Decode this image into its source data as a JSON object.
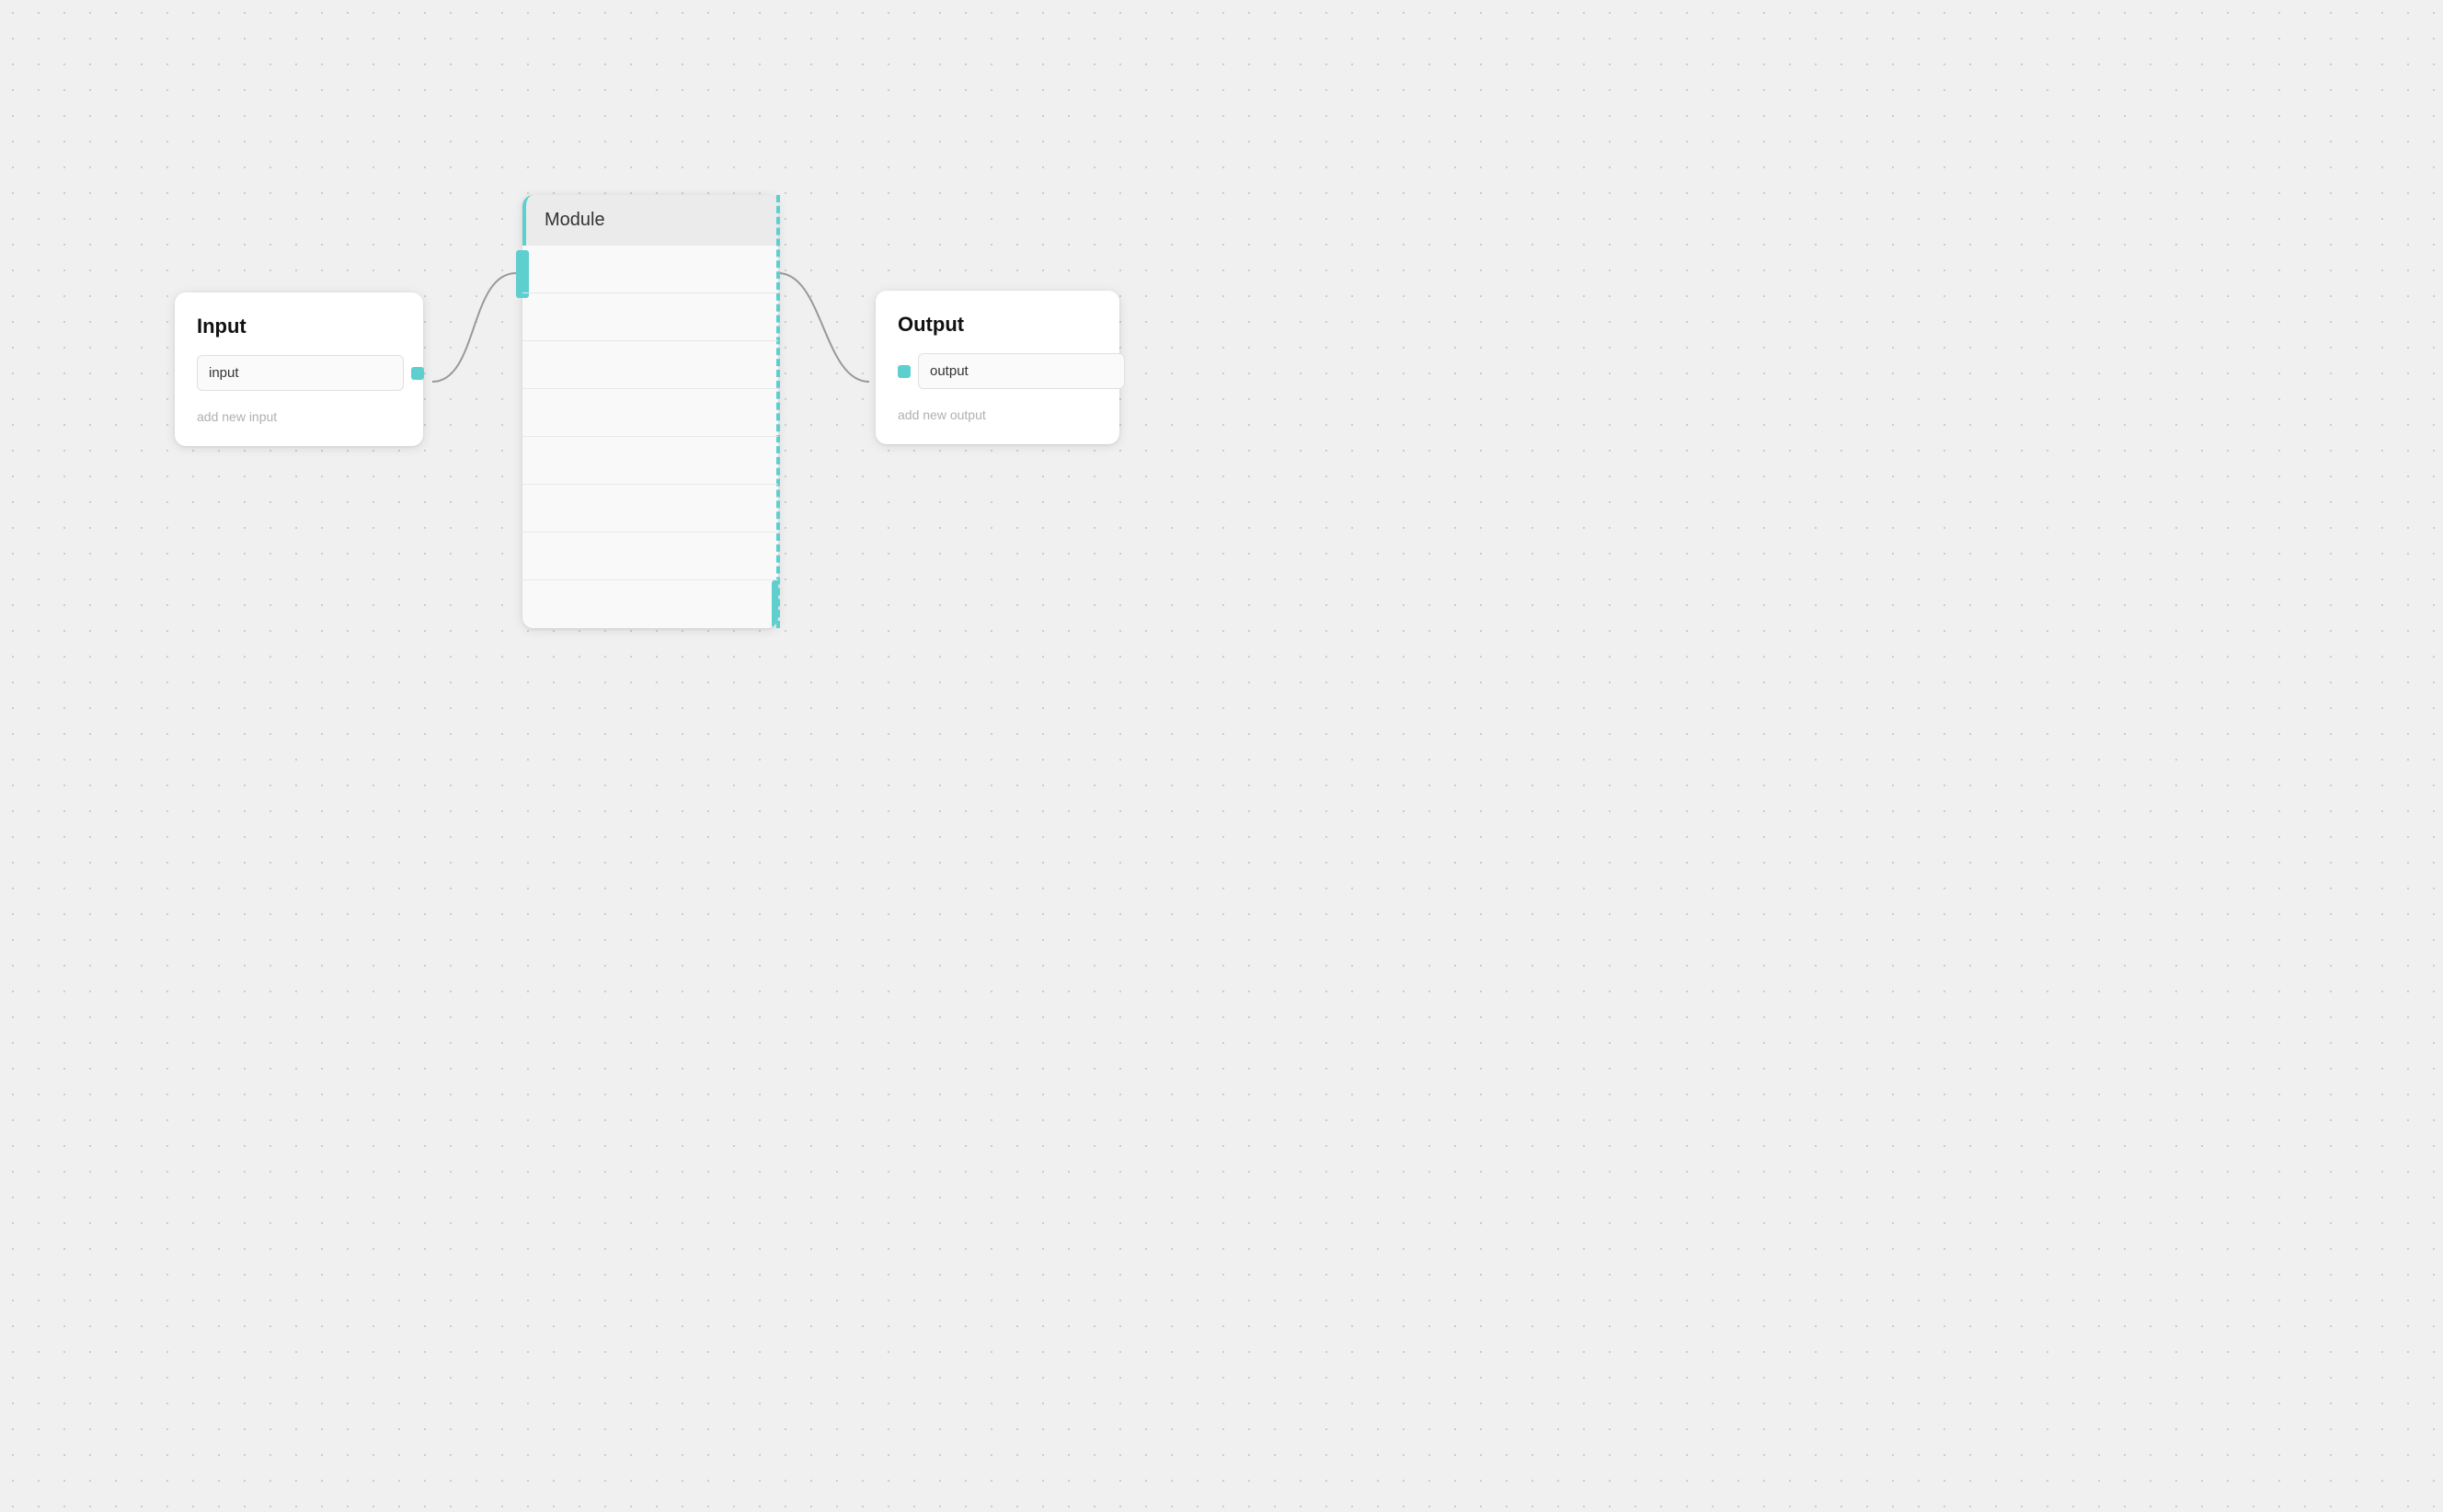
{
  "input_node": {
    "title": "Input",
    "field_value": "input",
    "add_label": "add new input"
  },
  "module_node": {
    "title": "Module",
    "row_count": 8
  },
  "output_node": {
    "title": "Output",
    "field_value": "output",
    "add_label": "add new output"
  },
  "colors": {
    "teal": "#5ecfcf",
    "connection": "#999999"
  }
}
